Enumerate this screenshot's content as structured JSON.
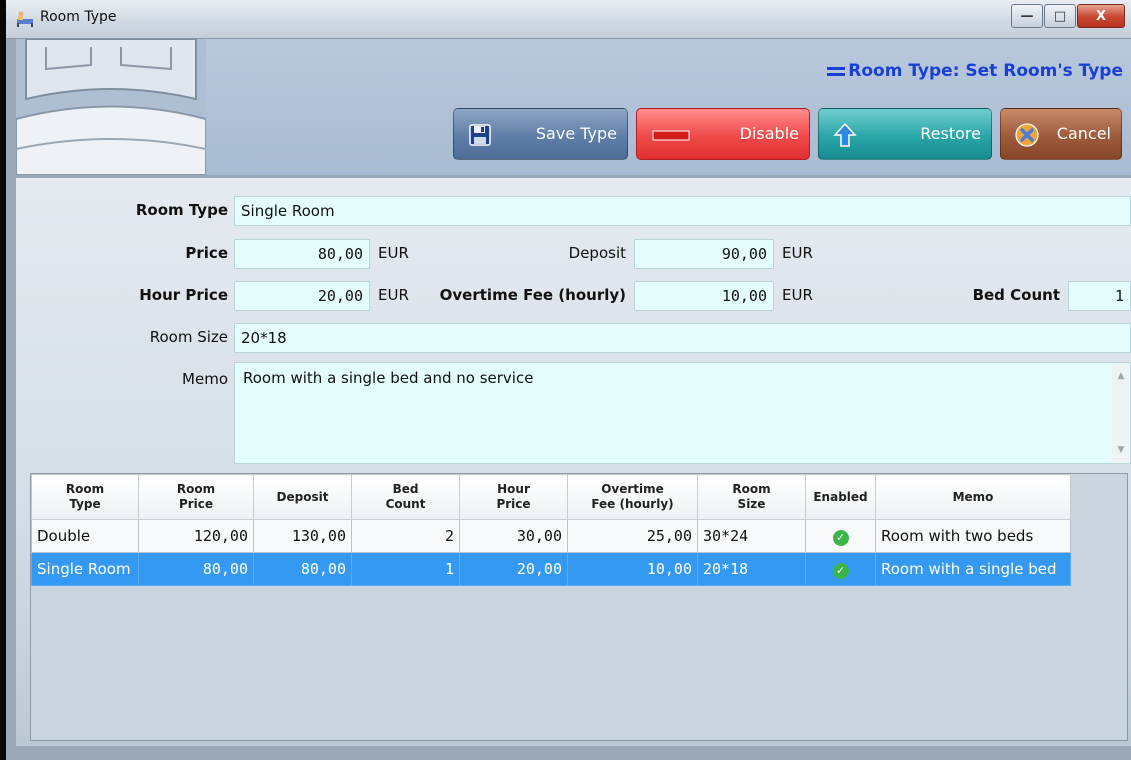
{
  "window": {
    "title": "Room Type",
    "minimize": "—",
    "maximize": "□",
    "close": "X"
  },
  "header": {
    "title": "Room Type: Set Room's Type"
  },
  "toolbar": {
    "save_label": "Save Type",
    "disable_label": "Disable",
    "restore_label": "Restore",
    "cancel_label": "Cancel",
    "save_color": "#5f7ea8",
    "disable_color": "#f04a4a",
    "restore_color": "#2aa5a8",
    "cancel_color": "#9e5a3c"
  },
  "form": {
    "room_type_label": "Room Type",
    "room_type_value": "Single Room",
    "price_label": "Price",
    "price_value": "80,00",
    "price_unit": "EUR",
    "deposit_label": "Deposit",
    "deposit_value": "90,00",
    "deposit_unit": "EUR",
    "hour_price_label": "Hour Price",
    "hour_price_value": "20,00",
    "hour_price_unit": "EUR",
    "overtime_label": "Overtime Fee (hourly)",
    "overtime_value": "10,00",
    "overtime_unit": "EUR",
    "bed_count_label": "Bed Count",
    "bed_count_value": "1",
    "room_size_label": "Room Size",
    "room_size_value": "20*18",
    "memo_label": "Memo",
    "memo_value": "Room with a single bed and no service"
  },
  "table": {
    "headers": {
      "room_type_1": "Room",
      "room_type_2": "Type",
      "room_price_1": "Room",
      "room_price_2": "Price",
      "deposit": "Deposit",
      "bed_count_1": "Bed",
      "bed_count_2": "Count",
      "hour_price_1": "Hour",
      "hour_price_2": "Price",
      "overtime_1": "Overtime",
      "overtime_2": "Fee (hourly)",
      "room_size_1": "Room",
      "room_size_2": "Size",
      "enabled": "Enabled",
      "memo": "Memo"
    },
    "rows": [
      {
        "room_type": "Double",
        "room_price": "120,00",
        "deposit": "130,00",
        "bed_count": "2",
        "hour_price": "30,00",
        "overtime": "25,00",
        "room_size": "30*24",
        "enabled": "✓",
        "memo": "Room with two beds"
      },
      {
        "room_type": "Single Room",
        "room_price": "80,00",
        "deposit": "80,00",
        "bed_count": "1",
        "hour_price": "20,00",
        "overtime": "10,00",
        "room_size": "20*18",
        "enabled": "✓",
        "memo": "Room with a single bed"
      }
    ]
  }
}
